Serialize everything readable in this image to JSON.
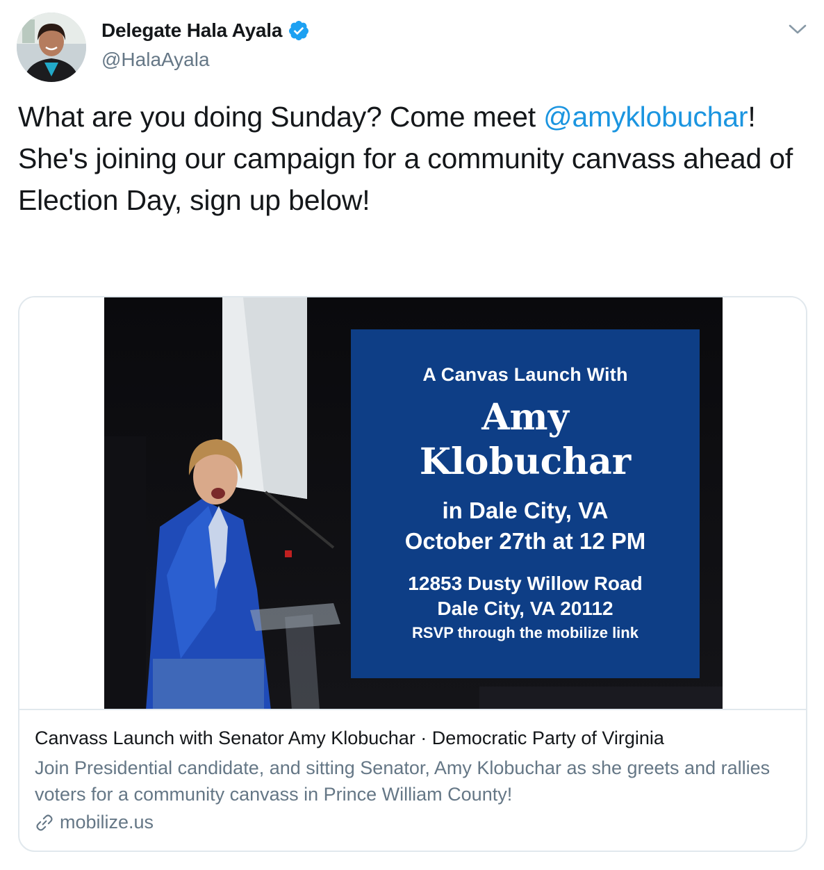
{
  "author": {
    "display_name": "Delegate Hala Ayala",
    "handle": "@HalaAyala",
    "verified": true,
    "verified_color": "#1da1f2"
  },
  "tweet": {
    "text_part1": "What are you doing Sunday? Come meet ",
    "mention": "@amyklobuchar",
    "text_part2": "! She's joining our campaign for a community canvass ahead of Election Day, sign up below!",
    "mention_color": "#1b95e0"
  },
  "card": {
    "image": {
      "line_launch": "A Canvas Launch With",
      "line_name1": "Amy",
      "line_name2": "Klobuchar",
      "line_city": "in Dale City, VA",
      "line_date": "October 27th at 12 PM",
      "line_address1": "12853 Dusty Willow Road",
      "line_address2": "Dale City, VA 20112",
      "line_rsvp": "RSVP through the mobilize link",
      "panel_color": "#0e3e86"
    },
    "title": "Canvass Launch with Senator Amy Klobuchar · Democratic Party of Virginia",
    "description": "Join Presidential candidate, and sitting Senator, Amy Klobuchar as she greets and rallies voters for a community canvass in Prince William County!",
    "domain": "mobilize.us",
    "link_icon": "link-icon"
  },
  "icons": {
    "caret": "chevron-down-icon",
    "verified": "verified-badge-icon"
  }
}
